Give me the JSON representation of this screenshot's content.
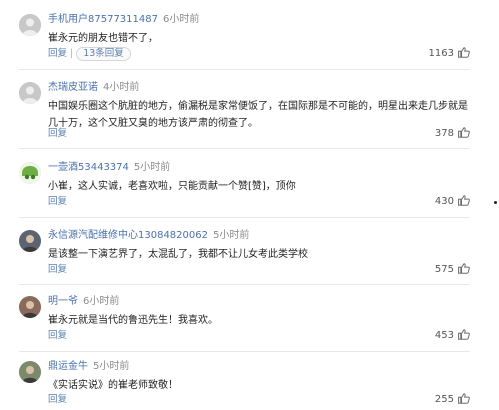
{
  "comments": [
    {
      "username": "手机用户87577311487",
      "time": "6小时前",
      "lines": [
        "崔永元的朋友也错不了，"
      ],
      "reply_label": "回复",
      "replies_label": "13条回复",
      "likes": "1163",
      "avatar": {
        "name": "avatar-gray",
        "color": "#c8c8c8"
      }
    },
    {
      "username": "杰瑞皮亚诺",
      "time": "4小时前",
      "lines": [
        "中国娱乐圈这个肮脏的地方，偷漏税是家常便饭了，在国际那是不可能的，明星出来走几步就是",
        "几十万，这个又脏又臭的地方该严肃的彻查了。"
      ],
      "reply_label": "回复",
      "replies_label": "",
      "likes": "378",
      "avatar": {
        "name": "avatar-gray",
        "color": "#c8c8c8"
      }
    },
    {
      "username": "一壶酒53443374",
      "time": "5小时前",
      "lines": [
        "小崔，这人实诚，老喜欢啦，只能贡献一个赞[赞]，顶你"
      ],
      "reply_label": "回复",
      "replies_label": "",
      "likes": "430",
      "avatar": {
        "name": "avatar-green",
        "color": "#6fae45"
      }
    },
    {
      "username": "永信源汽配维修中心13084820062",
      "time": "5小时前",
      "lines": [
        "是该整一下演艺界了，太混乱了，我都不让儿女考此类学校"
      ],
      "reply_label": "回复",
      "replies_label": "",
      "likes": "575",
      "avatar": {
        "name": "avatar-photo",
        "color": "#5b6470"
      }
    },
    {
      "username": "明一爷",
      "time": "6小时前",
      "lines": [
        "崔永元就是当代的鲁迅先生！我喜欢。"
      ],
      "reply_label": "回复",
      "replies_label": "",
      "likes": "453",
      "avatar": {
        "name": "avatar-photo",
        "color": "#8a6a5a"
      }
    },
    {
      "username": "鼎运金牛",
      "time": "5小时前",
      "lines": [
        "《实话实说》的崔老师致敬！"
      ],
      "reply_label": "回复",
      "replies_label": "",
      "likes": "255",
      "avatar": {
        "name": "avatar-photo",
        "color": "#7a8a6a"
      }
    }
  ],
  "colors": {
    "username": "#4a72ad",
    "link": "#5a7fae",
    "time": "#8b8b8b",
    "text": "#222222",
    "divider": "#e8e8e8"
  },
  "icons": {
    "like": "thumbs-up-icon"
  }
}
